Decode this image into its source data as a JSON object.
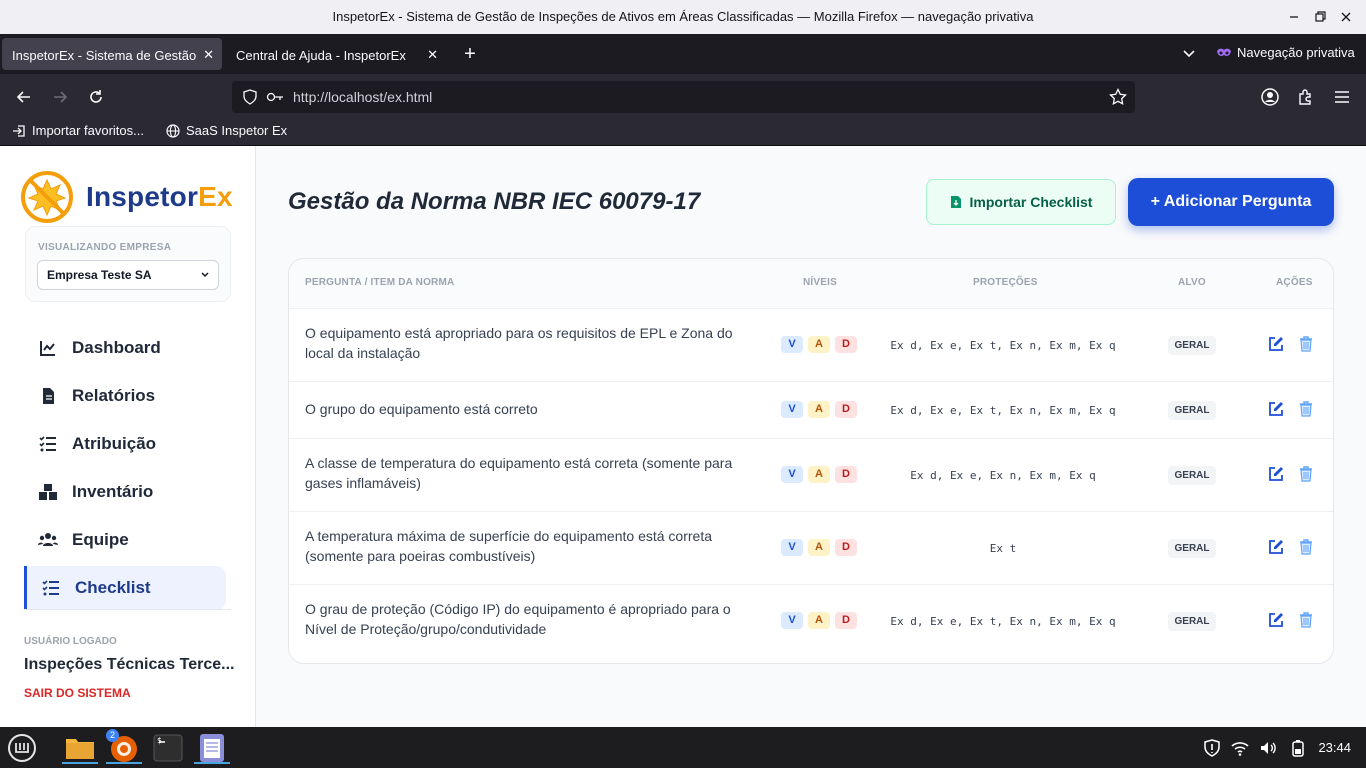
{
  "window": {
    "title": "InspetorEx - Sistema de Gestão de Inspeções de Ativos em Áreas Classificadas — Mozilla Firefox — navegação privativa"
  },
  "tabs": [
    {
      "label": "InspetorEx - Sistema de Gestão de",
      "active": true
    },
    {
      "label": "Central de Ajuda - InspetorEx",
      "active": false
    }
  ],
  "browser": {
    "private_label": "Navegação privativa",
    "url": "http://localhost/ex.html",
    "bookmarks": [
      "Importar favoritos...",
      "SaaS Inspetor Ex"
    ]
  },
  "sidebar": {
    "brand_main": "Inspetor",
    "brand_accent": "Ex",
    "company_label": "VISUALIZANDO EMPRESA",
    "company_value": "Empresa Teste SA",
    "menu": [
      {
        "label": "Dashboard",
        "icon": "chart-line-icon"
      },
      {
        "label": "Relatórios",
        "icon": "file-icon"
      },
      {
        "label": "Atribuição",
        "icon": "list-check-icon"
      },
      {
        "label": "Inventário",
        "icon": "boxes-icon"
      },
      {
        "label": "Equipe",
        "icon": "users-icon"
      },
      {
        "label": "Checklist",
        "icon": "list-check-icon",
        "active": true
      }
    ],
    "user_label": "USUÁRIO LOGADO",
    "user_name": "Inspeções Técnicas Terce...",
    "logout": "SAIR DO SISTEMA"
  },
  "main": {
    "title": "Gestão da Norma NBR IEC 60079-17",
    "import_button": "Importar Checklist",
    "add_button": "+ Adicionar Pergunta",
    "columns": [
      "PERGUNTA / ITEM DA NORMA",
      "NÍVEIS",
      "PROTEÇÕES",
      "ALVO",
      "AÇÕES"
    ],
    "level_badges": [
      "V",
      "A",
      "D"
    ],
    "rows": [
      {
        "question": "O equipamento está apropriado para os requisitos de EPL e Zona do local da instalação",
        "protections": "Ex d, Ex e, Ex t, Ex n, Ex m, Ex q",
        "target": "GERAL"
      },
      {
        "question": "O grupo do equipamento está correto",
        "protections": "Ex d, Ex e, Ex t, Ex n, Ex m, Ex q",
        "target": "GERAL"
      },
      {
        "question": "A classe de temperatura do equipamento está correta (somente para gases inflamáveis)",
        "protections": "Ex d, Ex e, Ex n, Ex m, Ex q",
        "target": "GERAL"
      },
      {
        "question": "A temperatura máxima de superfície do equipamento está correta (somente para poeiras combustíveis)",
        "protections": "Ex t",
        "target": "GERAL"
      },
      {
        "question": "O grau de proteção (Código IP) do equipamento é apropriado para o Nível de Proteção/grupo/condutividade",
        "protections": "Ex d, Ex e, Ex t, Ex n, Ex m, Ex q",
        "target": "GERAL"
      }
    ]
  },
  "taskbar": {
    "badge": "2",
    "clock": "23:44"
  },
  "colors": {
    "primary": "#1d4ed8",
    "brand_dark": "#1e3a8a",
    "brand_accent": "#f59e0b",
    "danger": "#dc2626",
    "success": "#065f46"
  }
}
